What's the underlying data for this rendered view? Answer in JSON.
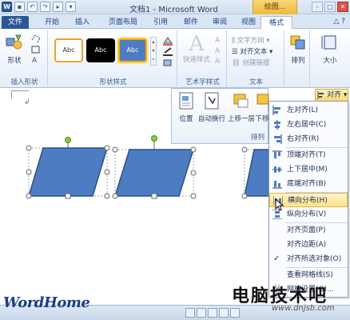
{
  "window": {
    "title": "文档1 - Microsoft Word",
    "context_tab_group": "绘图...",
    "qat_word_icon": "W"
  },
  "tabs": [
    "文件",
    "开始",
    "插入",
    "页面布局",
    "引用",
    "邮件",
    "审阅",
    "视图",
    "格式"
  ],
  "ribbon": {
    "insert_shapes": {
      "shapes_label": "形状",
      "group_label": "插入形状"
    },
    "shape_styles": {
      "style_sample": "Abc",
      "group_label": "形状样式"
    },
    "wordart": {
      "quick_styles_label": "快速样式",
      "a_glyph": "A",
      "group_label": "艺术字样式"
    },
    "text": {
      "direction_label": "文字方向",
      "align_text_label": "对齐文本",
      "create_link_label": "创建链接",
      "group_label": "文本"
    },
    "arrange": {
      "label": "排列"
    },
    "size": {
      "label": "大小"
    }
  },
  "arrange_panel": {
    "position_label": "位置",
    "wrap_label": "自动换行",
    "bring_forward_label": "上移一层",
    "send_backward_label": "下移",
    "group_label": "排列"
  },
  "align_button": {
    "label": "对齐"
  },
  "align_menu": {
    "items": [
      {
        "label": "左对齐(L)",
        "enabled": true
      },
      {
        "label": "左右居中(C)",
        "enabled": true
      },
      {
        "label": "右对齐(R)",
        "enabled": true
      },
      {
        "label": "顶端对齐(T)",
        "enabled": true
      },
      {
        "label": "上下居中(M)",
        "enabled": true
      },
      {
        "label": "底端对齐(B)",
        "enabled": true
      },
      {
        "label": "横向分布(H)",
        "enabled": true,
        "highlighted": true
      },
      {
        "label": "纵向分布(V)",
        "enabled": true
      },
      {
        "label": "对齐页面(P)",
        "enabled": true
      },
      {
        "label": "对齐边距(A)",
        "enabled": true
      },
      {
        "label": "对齐所选对象(O)",
        "enabled": true,
        "checked": true
      },
      {
        "label": "查看网格线(S)",
        "enabled": true
      },
      {
        "label": "网格设置(G)...",
        "enabled": true
      }
    ]
  },
  "watermarks": {
    "wordhome": "WordHome",
    "site_cn": "电脑技术吧",
    "site_url": "www.dnjsb.com"
  },
  "colors": {
    "shape_fill": "#4e7cc2",
    "shape_stroke": "#2c4f86",
    "rotate_handle": "#7fd13b",
    "file_tab": "#2b5797",
    "highlight": "#ffe38a"
  },
  "icons": [
    "save-icon",
    "undo-icon",
    "redo-icon",
    "shapes-icon",
    "position-icon",
    "wrap-text-icon",
    "bring-forward-icon",
    "send-backward-icon",
    "align-icon",
    "cursor-icon"
  ]
}
